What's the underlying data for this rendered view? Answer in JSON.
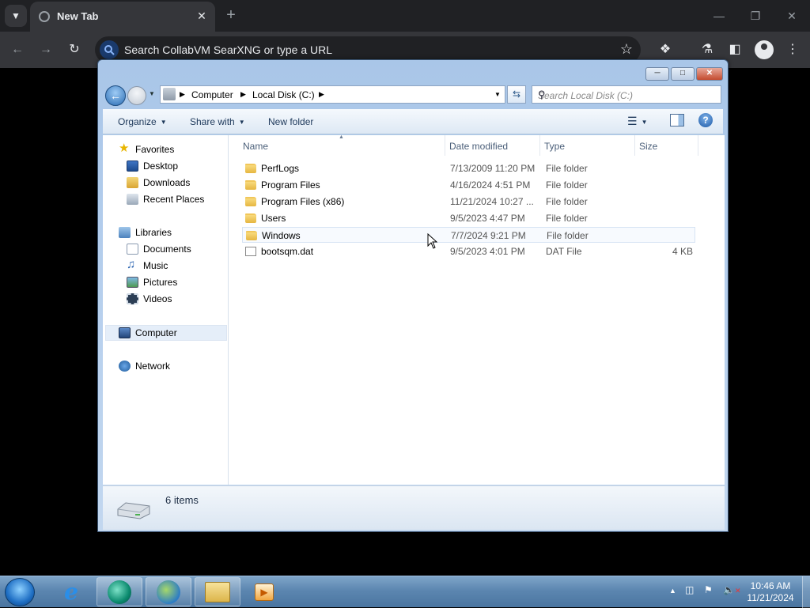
{
  "browser": {
    "tab_title": "New Tab",
    "omnibox_text": "Search CollabVM SearXNG or type a URL"
  },
  "explorer": {
    "breadcrumb": [
      "Computer",
      "Local Disk (C:)"
    ],
    "search_placeholder": "Search Local Disk (C:)",
    "toolbar": {
      "organize": "Organize",
      "share_with": "Share with",
      "new_folder": "New folder"
    },
    "nav": {
      "favorites": "Favorites",
      "desktop": "Desktop",
      "downloads": "Downloads",
      "recent": "Recent Places",
      "libraries": "Libraries",
      "documents": "Documents",
      "music": "Music",
      "pictures": "Pictures",
      "videos": "Videos",
      "computer": "Computer",
      "network": "Network"
    },
    "columns": {
      "name": "Name",
      "date": "Date modified",
      "type": "Type",
      "size": "Size"
    },
    "files": [
      {
        "name": "PerfLogs",
        "date": "7/13/2009 11:20 PM",
        "type": "File folder",
        "size": ""
      },
      {
        "name": "Program Files",
        "date": "4/16/2024 4:51 PM",
        "type": "File folder",
        "size": ""
      },
      {
        "name": "Program Files (x86)",
        "date": "11/21/2024 10:27 ...",
        "type": "File folder",
        "size": ""
      },
      {
        "name": "Users",
        "date": "9/5/2023 4:47 PM",
        "type": "File folder",
        "size": ""
      },
      {
        "name": "Windows",
        "date": "7/7/2024 9:21 PM",
        "type": "File folder",
        "size": ""
      },
      {
        "name": "bootsqm.dat",
        "date": "9/5/2023 4:01 PM",
        "type": "DAT File",
        "size": "4 KB"
      }
    ],
    "status": "6 items"
  },
  "taskbar": {
    "time": "10:46 AM",
    "date": "11/21/2024"
  }
}
